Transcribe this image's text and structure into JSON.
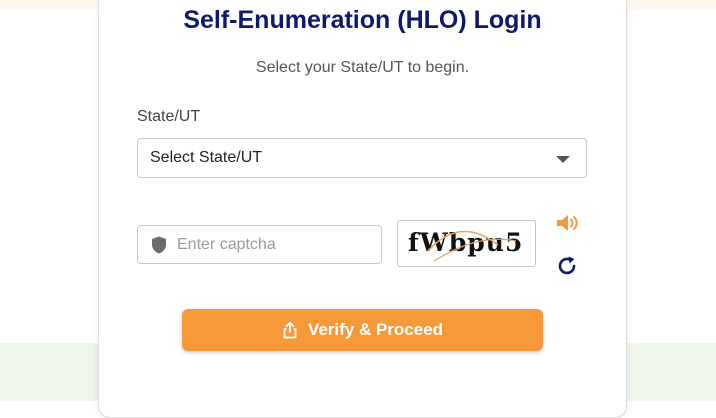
{
  "login": {
    "title": "Self-Enumeration (HLO) Login",
    "subtitle": "Select your State/UT to begin.",
    "state_label": "State/UT",
    "state_select_value": "Select State/UT",
    "captcha_placeholder": "Enter captcha",
    "captcha_text": "fWbpu5",
    "verify_label": "Verify & Proceed"
  },
  "icons": {
    "captcha_field": "shield-icon",
    "audio": "speaker-icon",
    "refresh": "refresh-icon",
    "verify": "share-icon",
    "select": "chevron-down-icon"
  },
  "colors": {
    "title": "#10186e",
    "accent": "#f6993a",
    "refresh": "#10186e",
    "page_top": "#fdf8ee",
    "page_bottom": "#eef6ec"
  }
}
